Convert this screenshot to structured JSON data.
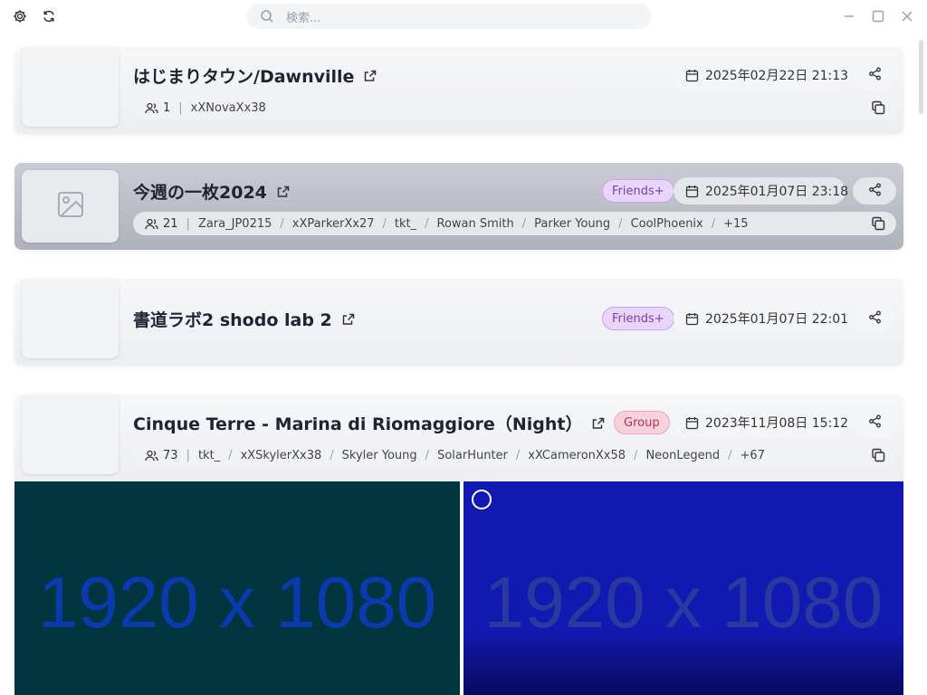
{
  "toolbar": {
    "settings_icon": "gear-icon",
    "refresh_icon": "refresh-icon"
  },
  "search": {
    "placeholder": "検索..."
  },
  "window_controls": [
    "minimize-icon",
    "maximize-icon",
    "close-icon"
  ],
  "cards": [
    {
      "title": "はじまりタウン/Dawnville",
      "badge": "",
      "date": "2025年02月22日 21:13",
      "player_count": "1",
      "players": [
        "xXNovaXx38"
      ],
      "more": ""
    },
    {
      "title": "今週の一枚2024",
      "badge": "Friends+",
      "date": "2025年01月07日 23:18",
      "player_count": "21",
      "players": [
        "Zara_JP0215",
        "xXParkerXx27",
        "tkt_",
        "Rowan Smith",
        "Parker Young",
        "CoolPhoenix"
      ],
      "more": "+15"
    },
    {
      "title": "書道ラボ2 shodo lab 2",
      "badge": "Friends+",
      "date": "2025年01月07日 22:01"
    },
    {
      "title": "Cinque Terre - Marina di Riomaggiore（Night）",
      "badge": "Group",
      "date": "2023年11月08日 15:12",
      "player_count": "73",
      "players": [
        "tkt_",
        "xXSkylerXx38",
        "Skyler Young",
        "SolarHunter",
        "xXCameronXx58",
        "NeonLegend"
      ],
      "more": "+67"
    }
  ],
  "screenshots": [
    {
      "label": "1920 x 1080",
      "color": "#003540"
    },
    {
      "label": "1920 x 1080",
      "color": "#1219b0"
    }
  ],
  "colors": {
    "friends_badge": "#e9d5f9",
    "group_badge": "#f7d1dc",
    "dark_card": "#b5b9c2"
  }
}
